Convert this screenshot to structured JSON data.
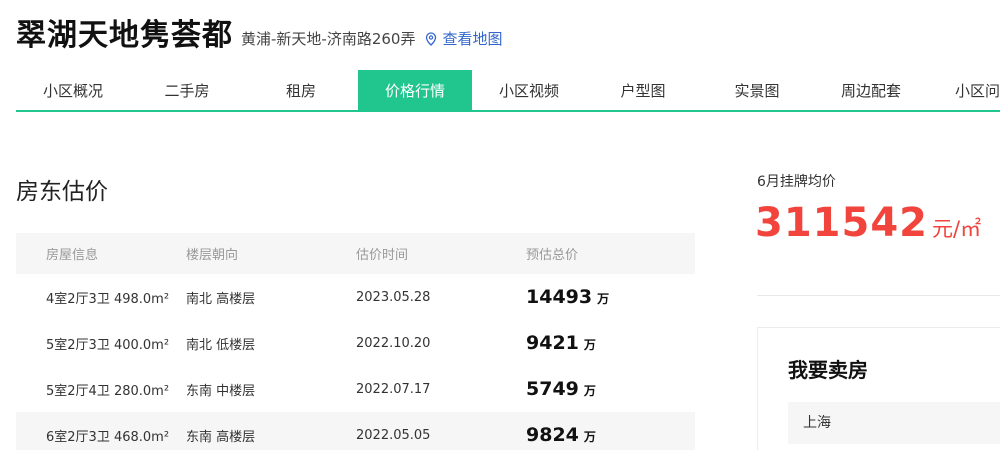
{
  "header": {
    "title": "翠湖天地隽荟都",
    "address": "黄浦-新天地-济南路260弄",
    "map_link": "查看地图"
  },
  "nav": {
    "items": [
      {
        "label": "小区概况"
      },
      {
        "label": "二手房"
      },
      {
        "label": "租房"
      },
      {
        "label": "价格行情",
        "active": true
      },
      {
        "label": "小区视频"
      },
      {
        "label": "户型图"
      },
      {
        "label": "实景图"
      },
      {
        "label": "周边配套"
      },
      {
        "label": "小区问答"
      }
    ]
  },
  "estimate": {
    "title": "房东估价",
    "columns": [
      "房屋信息",
      "楼层朝向",
      "估价时间",
      "预估总价"
    ],
    "rows": [
      {
        "info": "4室2厅3卫  498.0m²",
        "floor": "南北 高楼层",
        "date": "2023.05.28",
        "price": "14493",
        "unit": "万"
      },
      {
        "info": "5室2厅3卫  400.0m²",
        "floor": "南北 低楼层",
        "date": "2022.10.20",
        "price": "9421",
        "unit": "万"
      },
      {
        "info": "5室2厅4卫  280.0m²",
        "floor": "东南 中楼层",
        "date": "2022.07.17",
        "price": "5749",
        "unit": "万"
      },
      {
        "info": "6室2厅3卫  468.0m²",
        "floor": "东南 高楼层",
        "date": "2022.05.05",
        "price": "9824",
        "unit": "万"
      }
    ]
  },
  "listing": {
    "label": "6月挂牌均价",
    "price": "311542",
    "unit": "元/㎡"
  },
  "sell": {
    "title": "我要卖房",
    "city": "上海"
  },
  "colors": {
    "accent_green": "#21c58e",
    "price_red": "#f0443c",
    "link_blue": "#3366cc"
  },
  "icons": {
    "map_link": "location-pin-icon"
  }
}
